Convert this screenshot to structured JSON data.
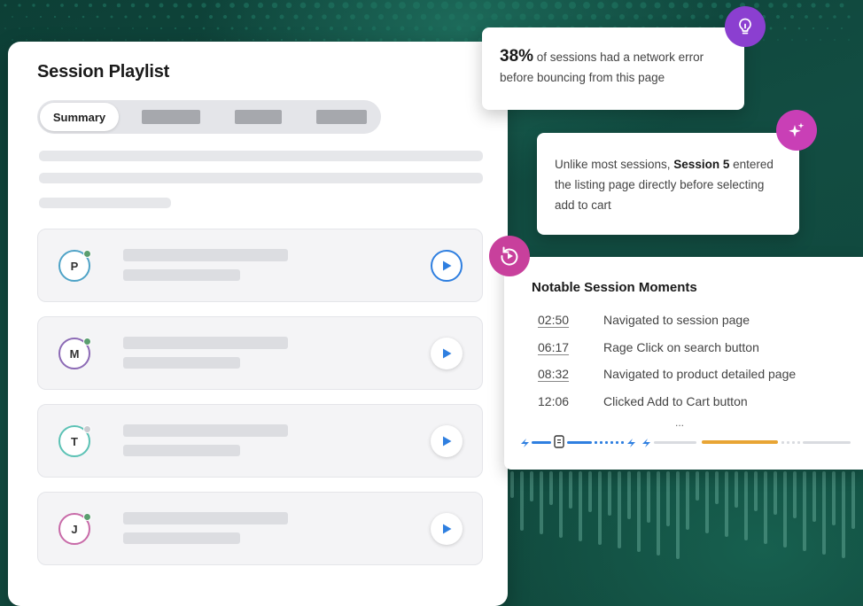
{
  "playlist": {
    "title": "Session Playlist",
    "tabs": [
      {
        "label": "Summary",
        "active": true
      }
    ],
    "sessions": [
      {
        "initial": "P",
        "ring_color": "#4fa3c7",
        "status_color": "#5a9e6f",
        "play_active": true
      },
      {
        "initial": "M",
        "ring_color": "#8c6ab5",
        "status_color": "#5a9e6f",
        "play_active": false
      },
      {
        "initial": "T",
        "ring_color": "#5cc2b5",
        "status_color": "#c9cbd0",
        "play_active": false
      },
      {
        "initial": "J",
        "ring_color": "#c86aa8",
        "status_color": "#5a9e6f",
        "play_active": false
      }
    ]
  },
  "insight_network": {
    "percent": "38%",
    "text": " of sessions had a network error before bouncing from this page",
    "icon": "lightbulb-icon"
  },
  "insight_session": {
    "text_before": "Unlike most sessions, ",
    "highlight": "Session 5",
    "text_after": " entered the listing page directly before selecting add to cart",
    "icon": "sparkle-icon"
  },
  "moments": {
    "title": "Notable Session Moments",
    "icon": "replay-icon",
    "items": [
      {
        "time": "02:50",
        "label": "Navigated to session page",
        "linked": true
      },
      {
        "time": "06:17",
        "label": "Rage Click on search button",
        "linked": true
      },
      {
        "time": "08:32",
        "label": "Navigated to product detailed page",
        "linked": true
      },
      {
        "time": "12:06",
        "label": "Clicked Add to Cart button",
        "linked": false
      }
    ],
    "more": "..."
  },
  "colors": {
    "background": "#0f4a3f",
    "accent_blue": "#2f7fe0",
    "timeline_progress": "#e8a535",
    "bulb_badge": "#8b3fd0",
    "spark_badge": "#c93fb6",
    "replay_badge": "#c8409c"
  }
}
